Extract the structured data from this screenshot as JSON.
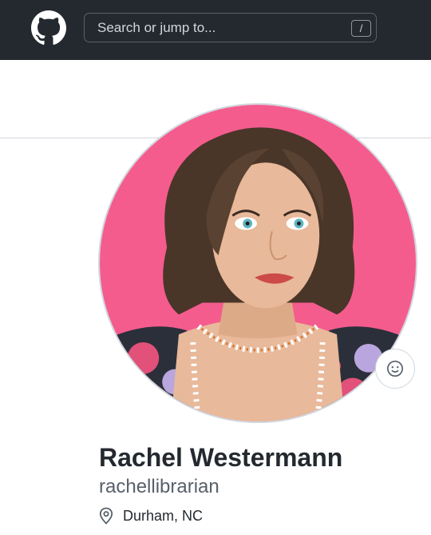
{
  "header": {
    "logo_icon": "github-mark-icon",
    "search": {
      "placeholder": "Search or jump to...",
      "shortcut_key": "/"
    }
  },
  "profile": {
    "avatar_alt": "rachellibrarian avatar",
    "status_icon": "smiley-icon",
    "full_name": "Rachel Westermann",
    "username": "rachellibrarian",
    "location_icon": "location-pin-icon",
    "location": "Durham, NC"
  },
  "colors": {
    "header_bg": "#24292f",
    "avatar_bg": "#f45c8e",
    "hair": "#4a3628",
    "skin": "#e8b99a",
    "text_primary": "#24292f",
    "text_secondary": "#57606a"
  }
}
